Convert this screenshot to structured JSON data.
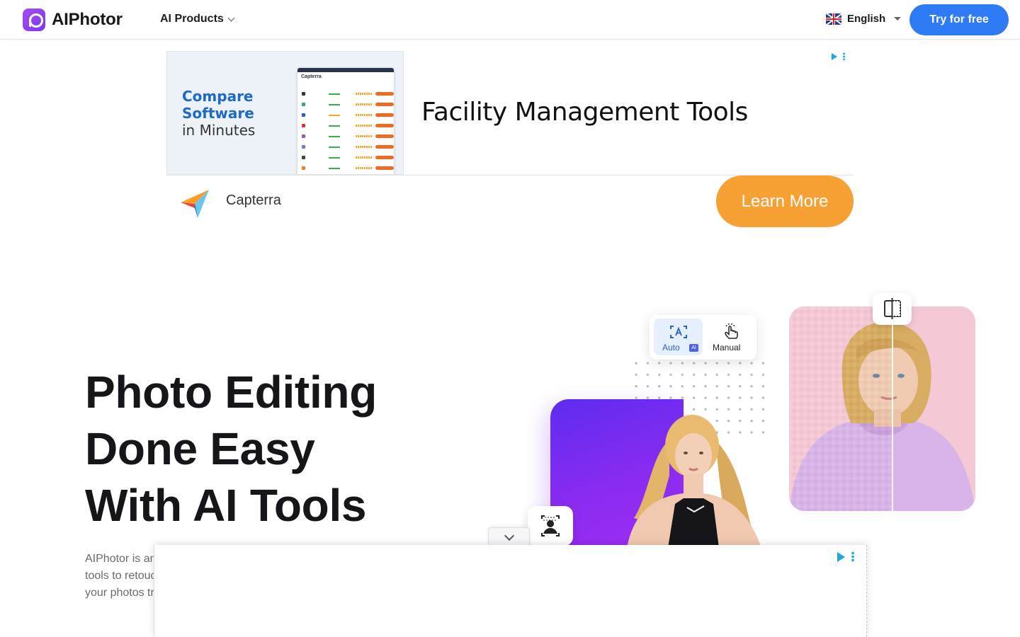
{
  "header": {
    "brand": "AIPhotor",
    "nav_products": "AI Products",
    "language": "English",
    "cta": "Try for free"
  },
  "ad_top": {
    "image_headline_bold_1": "Compare",
    "image_headline_bold_2": "Software",
    "image_headline_normal": "in Minutes",
    "mock_brand": "Capterra",
    "headline": "Facility Management Tools",
    "advertiser": "Capterra",
    "cta": "Learn More"
  },
  "hero": {
    "title_lines": [
      "Photo Editing",
      "Done Easy",
      "With AI Tools"
    ],
    "desc_lines": [
      "AIPhotor is an",
      "tools to retouc",
      "your photos tr"
    ]
  },
  "modes": {
    "auto_label": "Auto",
    "ai_badge": "AI",
    "manual_label": "Manual"
  },
  "colors": {
    "brand_purple": "#8a3df0",
    "cta_blue": "#2f7bf5",
    "ad_orange": "#f7a034",
    "ad_info_cyan": "#1fa8d8"
  }
}
